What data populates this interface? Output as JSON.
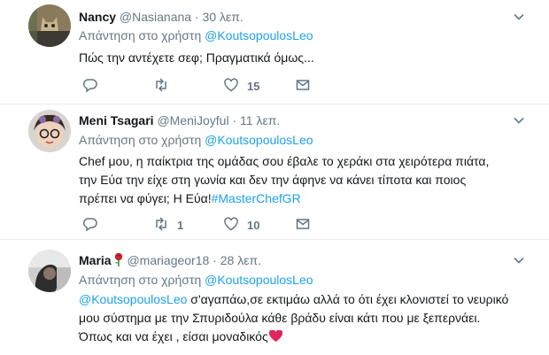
{
  "tweets": [
    {
      "name": "Nancy",
      "handle": "@Nasianana",
      "separator": "·",
      "time": "30 λεπ.",
      "reply_label": "Απάντηση στο χρήστη",
      "reply_mention": "@KoutsopoulosLeo",
      "text": "Πώς την αντέχετε σεφ;  Πραγματικά όμως...",
      "counts": {
        "reply": "",
        "retweet": "",
        "like": "15",
        "dm": ""
      }
    },
    {
      "name": "Meni Tsagari",
      "handle": "@MeniJoyful",
      "separator": "·",
      "time": "11 λεπ.",
      "reply_label": "Απάντηση στο χρήστη",
      "reply_mention": "@KoutsopoulosLeo",
      "text_line1": "Chef μου, η παίκτρια της ομάδας σου έβαλε το χεράκι στα χειρότερα πιάτα,",
      "text_line2": "την Εύα την είχε στη γωνία και δεν την άφηνε να κάνει τίποτα και ποιος",
      "text_line3": "πρέπει να φύγει; Η Εύα!",
      "hashtag": "#MasterChefGR",
      "counts": {
        "reply": "",
        "retweet": "1",
        "like": "10",
        "dm": ""
      }
    },
    {
      "name": "Maria",
      "handle": "@mariageor18",
      "separator": "·",
      "time": "28 λεπ.",
      "reply_label": "Απάντηση στο χρήστη",
      "reply_mention": "@KoutsopoulosLeo",
      "text_mention": "@KoutsopoulosLeo",
      "text_line1": " σ'αγαπάω,σε εκτιμάω αλλά το ότι έχει κλονιστεί το νευρικό",
      "text_line2": "μου σύστημα με την Σπυριδούλα κάθε βράδυ είναι κάτι που με ξεπερνάει.",
      "text_line3": "Όπως και να έχει , είσαι μοναδικός"
    }
  ],
  "colors": {
    "accent": "#1da1f2",
    "muted": "#657786",
    "border": "#e6ecf0",
    "heart": "#e0245e"
  },
  "icons": [
    "reply-icon",
    "retweet-icon",
    "like-icon",
    "direct-message-icon",
    "chevron-down-icon",
    "rose-emoji",
    "red-heart-emoji"
  ]
}
